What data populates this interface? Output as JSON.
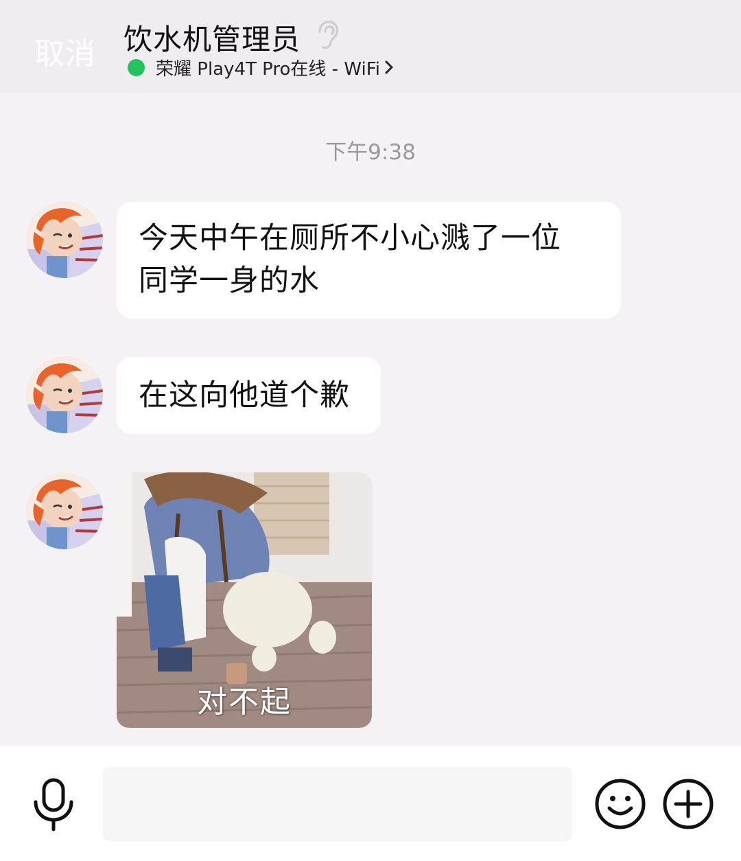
{
  "header": {
    "cancel_label": "取消",
    "title": "饮水机管理员",
    "status_text": "荣耀 Play4T Pro在线 - WiFi",
    "status_color": "#21c45a",
    "mode_icon": "ear-icon",
    "detail_icon": "chevron-right-icon"
  },
  "chat": {
    "timestamp": "下午9:38",
    "messages": [
      {
        "type": "text",
        "line1": "今天中午在厕所不小心溅了一位",
        "line2": "同学一身的水"
      },
      {
        "type": "text",
        "text": "在这向他道个歉"
      },
      {
        "type": "sticker",
        "caption": "对不起"
      }
    ]
  },
  "input_bar": {
    "placeholder": "",
    "value": "",
    "icons": [
      "microphone-icon",
      "emoji-icon",
      "plus-icon"
    ]
  },
  "colors": {
    "background": "#f4f2f5",
    "header_background": "#efedf0",
    "bubble": "#ffffff",
    "timestamp": "#9a989c"
  }
}
